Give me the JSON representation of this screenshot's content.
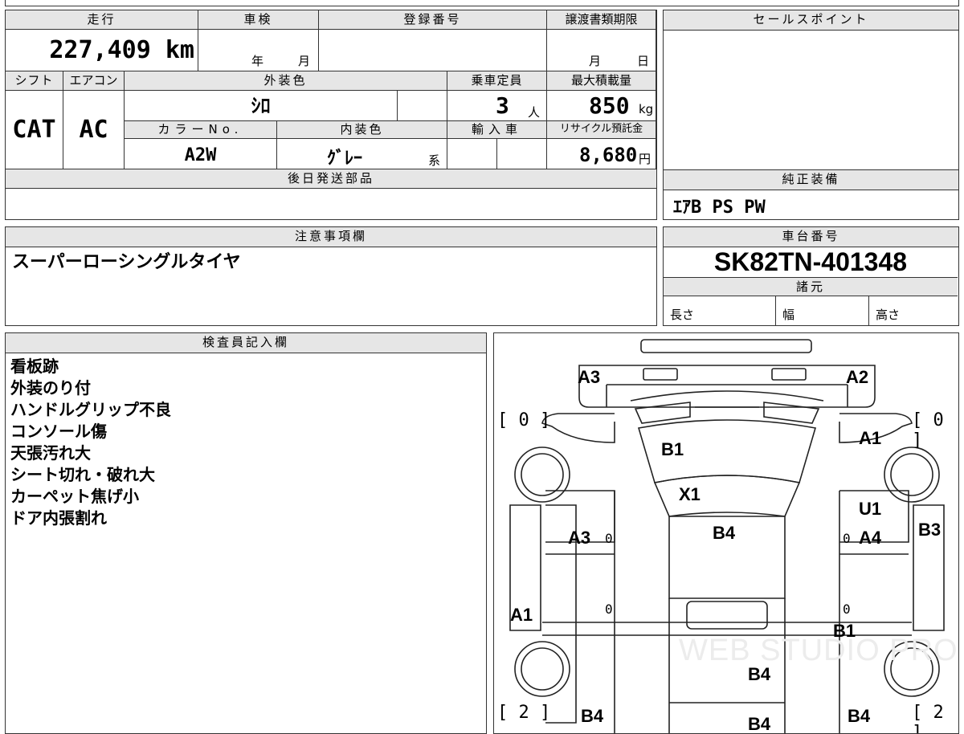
{
  "top": {
    "mileage_label": "走行",
    "mileage_value": "227,409 km",
    "shaken_label": "車検",
    "shaken_year": "年",
    "shaken_month": "月",
    "reg_label": "登録番号",
    "transfer_label": "譲渡書類期限",
    "transfer_month": "月",
    "transfer_day": "日",
    "shift_label": "シフト",
    "shift_value": "CAT",
    "ac_label": "エアコン",
    "ac_value": "AC",
    "exterior_label": "外装色",
    "exterior_value": "ｼﾛ",
    "capacity_label": "乗車定員",
    "capacity_value": "3",
    "capacity_unit": "人",
    "maxload_label": "最大積載量",
    "maxload_value": "850",
    "maxload_unit": "kg",
    "color_no_label": "カラーNo.",
    "color_no_value": "A2W",
    "interior_label": "内装色",
    "interior_value": "ｸﾞﾚｰ",
    "interior_suffix": "系",
    "import_label": "輸入車",
    "recycle_label": "リサイクル預託金",
    "recycle_value": "8,680",
    "recycle_unit": "円",
    "later_parts_label": "後日発送部品"
  },
  "sales": {
    "label": "セールスポイント",
    "equipment_label": "純正装備",
    "equipment_value": "ｴｱB PS PW"
  },
  "notes": {
    "label": "注意事項欄",
    "value": "スーパーローシングルタイヤ"
  },
  "chassis": {
    "label": "車台番号",
    "value": "SK82TN-401348",
    "spec_label": "諸元",
    "length": "長さ",
    "width": "幅",
    "height": "高さ"
  },
  "inspector": {
    "label": "検査員記入欄",
    "lines": [
      "看板跡",
      "外装のり付",
      "ハンドルグリップ不良",
      "コンソール傷",
      "天張汚れ大",
      "シート切れ・破れ大",
      "カーペット焦げ小",
      "ドア内張割れ"
    ]
  },
  "diagram": {
    "tire_fl": "[ 0 ]",
    "tire_fr": "[ 0 ]",
    "tire_rl": "[ 2 ]",
    "tire_rr": "[ 2 ]",
    "marks": {
      "front_left_corner": "A3",
      "front_right_corner": "A2",
      "hood": "B1",
      "front_right_fender": "A1",
      "cowl": "X1",
      "right_door_upper": "U1",
      "left_door": "A3",
      "roof": "B4",
      "right_door": "A4",
      "right_side": "B3",
      "left_side": "A1",
      "right_rear": "B1",
      "bed_mid": "B4",
      "rear_left": "B4",
      "rear_center": "B4",
      "rear_right": "B4"
    },
    "zero": "0",
    "watermark": "WEB STUDIO PRO"
  }
}
